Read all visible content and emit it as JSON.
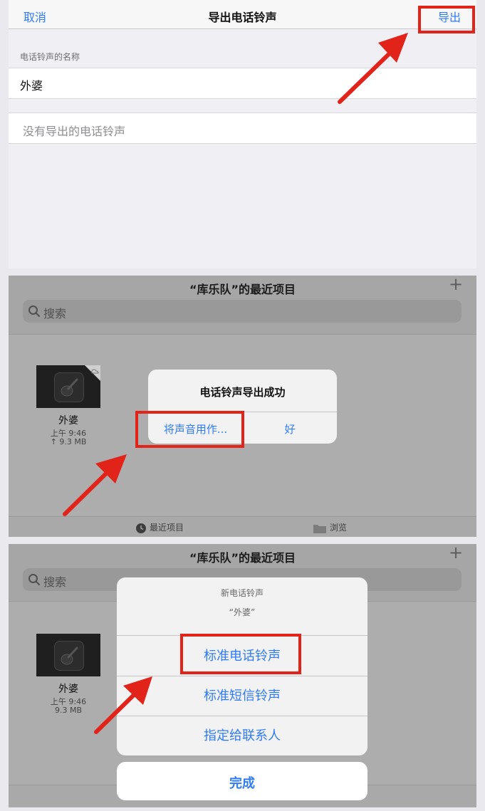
{
  "export_screen": {
    "cancel_label": "取消",
    "title": "导出电话铃声",
    "export_label": "导出",
    "section_label": "电话铃声的名称",
    "ringtone_name": "外婆",
    "empty_text": "没有导出的电话铃声"
  },
  "browser_success": {
    "title": "“库乐队”的最近项目",
    "plus_label": "+",
    "search_placeholder": "搜索",
    "file": {
      "name": "外婆",
      "time": "上午 9:46",
      "size": "↑ 9.3 MB"
    },
    "alert": {
      "title": "电话铃声导出成功",
      "use_sound_label": "将声音用作...",
      "ok_label": "好"
    },
    "tabs": {
      "recent": "最近项目",
      "browse": "浏览"
    }
  },
  "browser_sheet": {
    "title": "“库乐队”的最近项目",
    "plus_label": "+",
    "search_placeholder": "搜索",
    "file": {
      "name": "外婆",
      "time": "上午 9:46",
      "size": "9.3 MB"
    },
    "sheet": {
      "title": "新电话铃声",
      "message": "“外婆”",
      "options": [
        "标准电话铃声",
        "标准短信铃声",
        "指定给联系人"
      ],
      "done_label": "完成"
    }
  },
  "colors": {
    "accent": "#2f7cf6",
    "highlight": "#e2231a"
  }
}
